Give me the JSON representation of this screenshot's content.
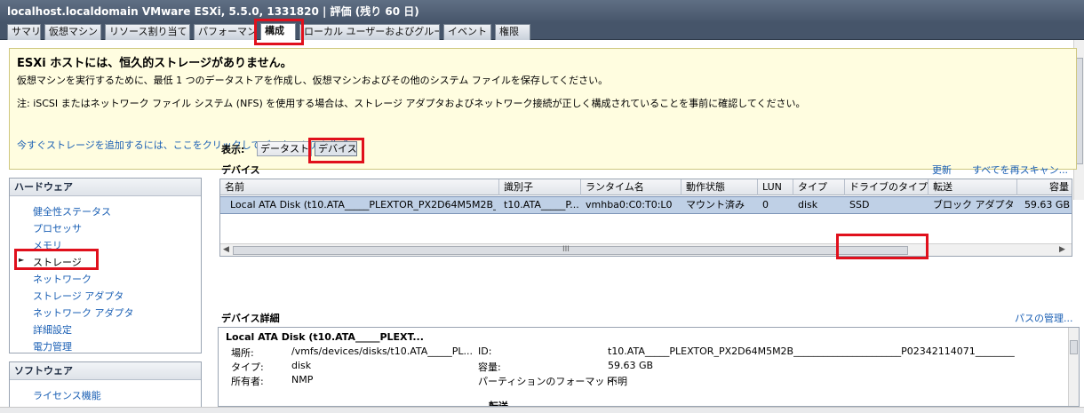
{
  "window": {
    "title": "localhost.localdomain VMware ESXi, 5.5.0, 1331820 | 評価 (残り 60 日)"
  },
  "tabs": [
    {
      "label": "サマリ"
    },
    {
      "label": "仮想マシン"
    },
    {
      "label": "リソース割り当て"
    },
    {
      "label": "パフォーマンス"
    },
    {
      "label": "構成"
    },
    {
      "label": "ローカル ユーザーおよびグループ"
    },
    {
      "label": "イベント"
    },
    {
      "label": "権限"
    }
  ],
  "warning": {
    "title": "ESXi ホストには、恒久的ストレージがありません。",
    "line1": "仮想マシンを実行するために、最低 1 つのデータストアを作成し、仮想マシンおよびその他のシステム ファイルを保存してください。",
    "line2": "注: iSCSI またはネットワーク ファイル システム (NFS) を使用する場合は、ストレージ アダプタおよびネットワーク接続が正しく構成されていることを事前に確認してください。",
    "link": "今すぐストレージを追加するには、ここをクリックしてデータストアを作成..."
  },
  "hardware": {
    "header": "ハードウェア",
    "items": [
      {
        "label": "健全性ステータス"
      },
      {
        "label": "プロセッサ"
      },
      {
        "label": "メモリ"
      },
      {
        "label": "ストレージ"
      },
      {
        "label": "ネットワーク"
      },
      {
        "label": "ストレージ アダプタ"
      },
      {
        "label": "ネットワーク アダプタ"
      },
      {
        "label": "詳細設定"
      },
      {
        "label": "電力管理"
      }
    ]
  },
  "software": {
    "header": "ソフトウェア",
    "items": [
      {
        "label": "ライセンス機能"
      }
    ]
  },
  "view": {
    "label": "表示:",
    "options": [
      {
        "label": "データストア"
      },
      {
        "label": "デバイス"
      }
    ]
  },
  "devices": {
    "title": "デバイス",
    "refresh": "更新",
    "rescan": "すべてを再スキャン...",
    "columns": [
      "名前",
      "識別子",
      "ランタイム名",
      "動作状態",
      "LUN",
      "タイプ",
      "ドライブのタイプ",
      "転送",
      "容量"
    ],
    "rows": [
      {
        "name": "Local ATA Disk (t10.ATA_____PLEXTOR_PX2D64M5M2B_...",
        "identifier": "t10.ATA_____P...",
        "runtime": "vmhba0:C0:T0:L0",
        "state": "マウント済み",
        "lun": "0",
        "type": "disk",
        "drive_type": "SSD",
        "transport": "ブロック アダプタ",
        "capacity": "59.63 GB"
      }
    ],
    "scroll_grip": "III"
  },
  "details": {
    "title": "デバイス詳細",
    "manage_paths": "パスの管理...",
    "device_name": "Local ATA Disk (t10.ATA_____PLEXT...",
    "location_label": "場所:",
    "location_value": "/vmfs/devices/disks/t10.ATA_____PL...",
    "type_label": "タイプ:",
    "type_value": "disk",
    "owner_label": "所有者:",
    "owner_value": "NMP",
    "id_label": "ID:",
    "id_value": "t10.ATA_____PLEXTOR_PX2D64M5M2B______________________P02342114071________",
    "capacity_label": "容量:",
    "capacity_value": "59.63 GB",
    "partition_label": "パーティションのフォーマット:",
    "partition_value": "不明",
    "cut_label": "転送"
  },
  "colors": {
    "highlight": "#e0101c",
    "link": "#1a5fb4",
    "selected_row": "#bfd0e6",
    "warning_bg": "#fffde0"
  }
}
